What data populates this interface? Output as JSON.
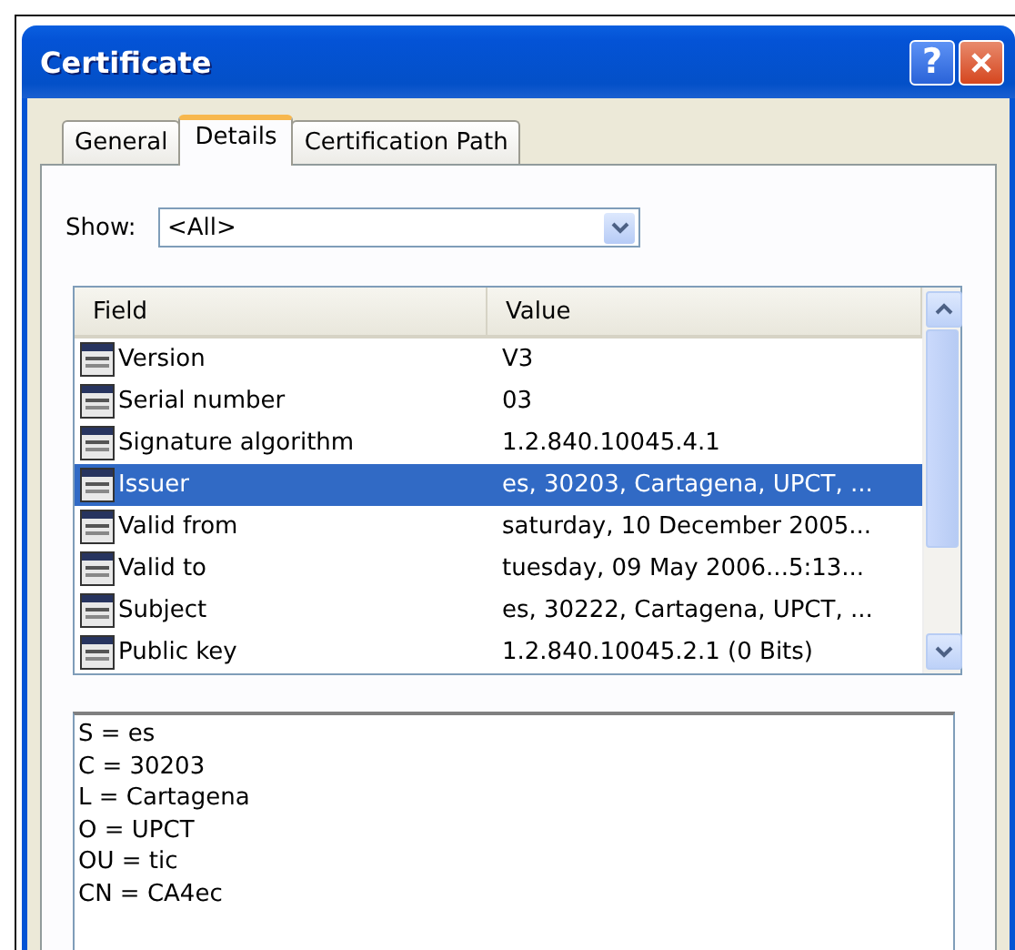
{
  "window": {
    "title": "Certificate",
    "help_button": "?"
  },
  "tabs": [
    {
      "label": "General",
      "selected": false
    },
    {
      "label": "Details",
      "selected": true
    },
    {
      "label": "Certification Path",
      "selected": false
    }
  ],
  "show": {
    "label": "Show:",
    "value": "<All>"
  },
  "table": {
    "columns": [
      "Field",
      "Value"
    ],
    "rows": [
      {
        "field": "Version",
        "value": "V3",
        "selected": false
      },
      {
        "field": "Serial number",
        "value": "03",
        "selected": false
      },
      {
        "field": "Signature algorithm",
        "value": "1.2.840.10045.4.1",
        "selected": false
      },
      {
        "field": "Issuer",
        "value": "es, 30203, Cartagena, UPCT, ...",
        "selected": true
      },
      {
        "field": "Valid from",
        "value": "saturday, 10 December 2005...",
        "selected": false
      },
      {
        "field": "Valid to",
        "value": "tuesday, 09 May 2006...5:13...",
        "selected": false
      },
      {
        "field": "Subject",
        "value": "es, 30222, Cartagena, UPCT, ...",
        "selected": false
      },
      {
        "field": "Public key",
        "value": "1.2.840.10045.2.1 (0 Bits)",
        "selected": false
      }
    ]
  },
  "details": [
    "S = es",
    "C = 30203",
    "L = Cartagena",
    "O = UPCT",
    "OU = tic",
    "CN = CA4ec"
  ]
}
